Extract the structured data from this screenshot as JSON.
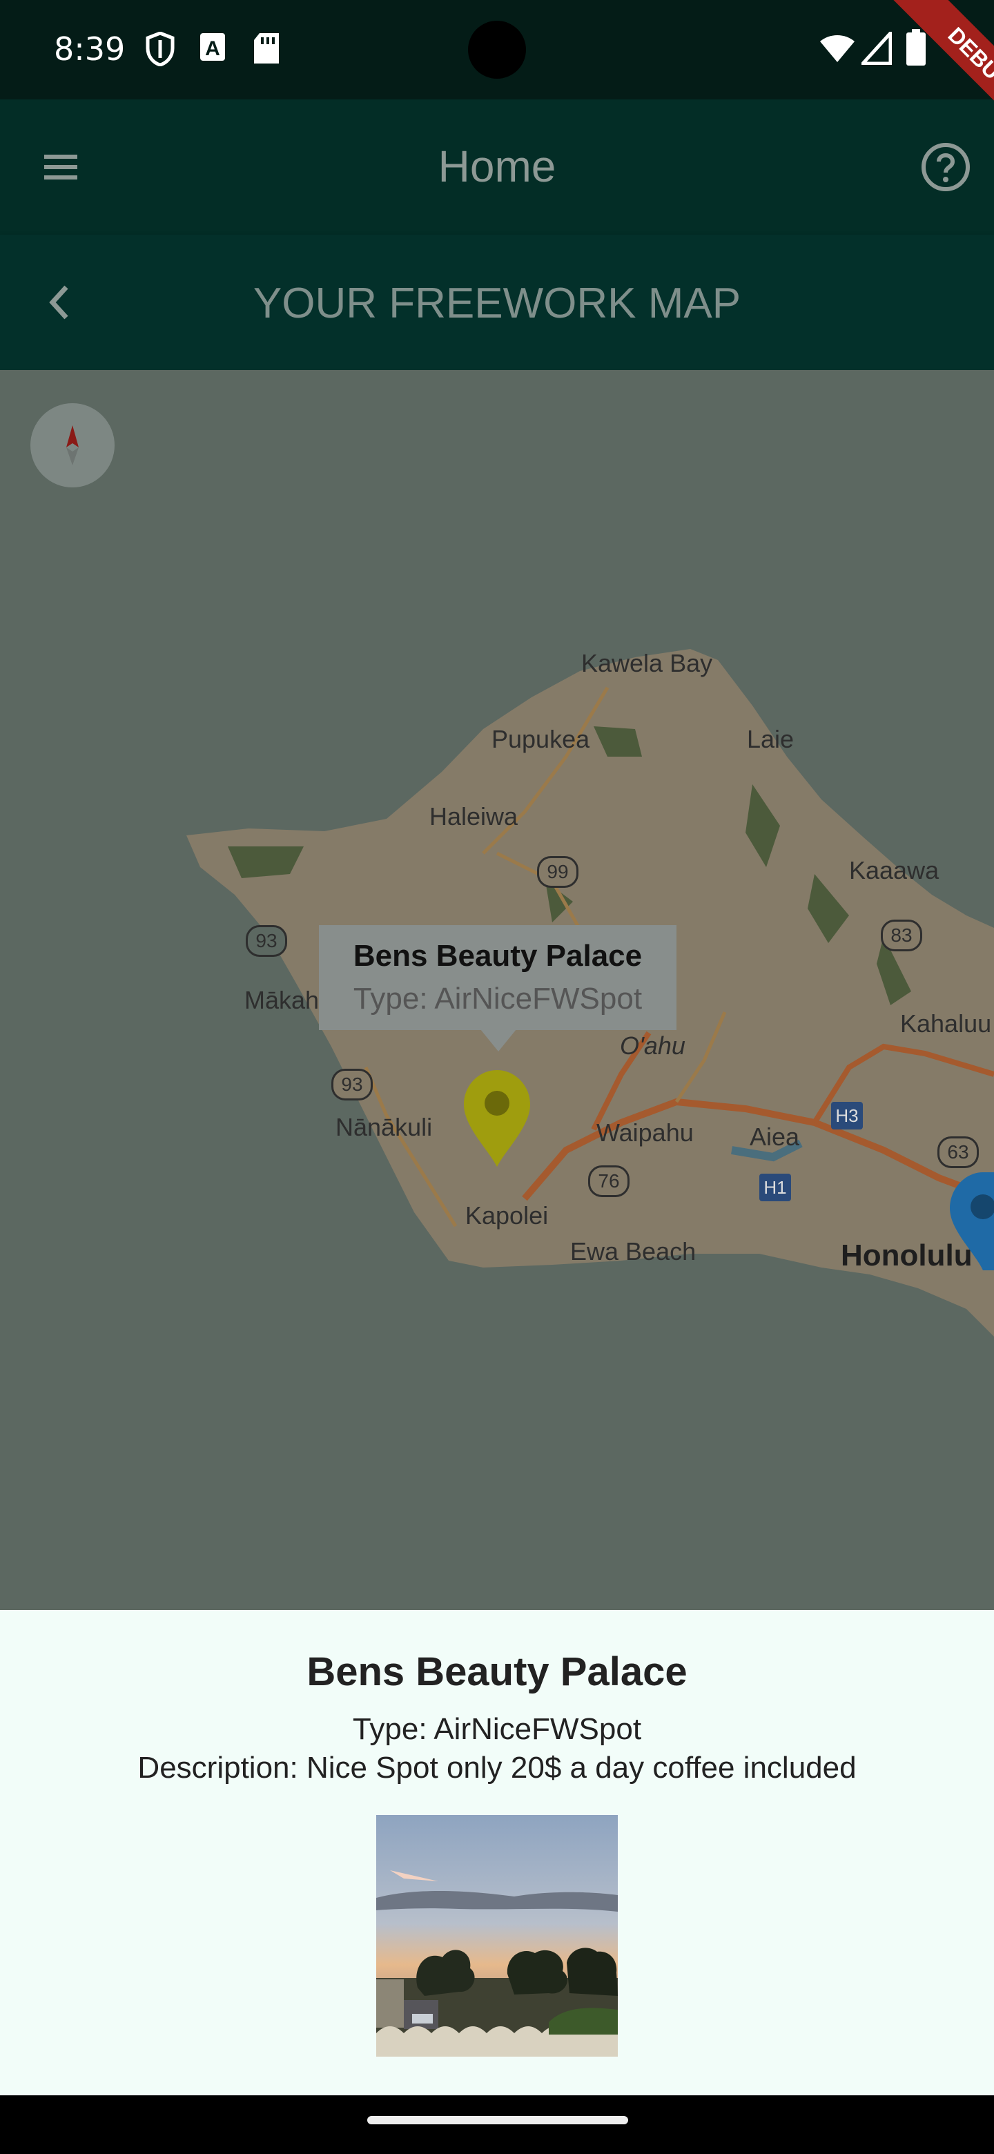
{
  "status_bar": {
    "time": "8:39"
  },
  "app_bar": {
    "title": "Home"
  },
  "sub_header": {
    "title": "YOUR FREEWORK MAP"
  },
  "debug_banner": {
    "label": "DEBUG"
  },
  "map": {
    "labels": {
      "kawela_bay": "Kawela Bay",
      "pupukea": "Pupukea",
      "laie": "Laie",
      "haleiwa": "Haleiwa",
      "kaaawa": "Kaaawa",
      "makaha": "Mākah",
      "kahaluu": "Kahaluu",
      "oahu": "O'ahu",
      "nanakuli": "Nānākuli",
      "waipahu": "Waipahu",
      "aiea": "Aiea",
      "kapolei": "Kapolei",
      "ewa_beach": "Ewa Beach",
      "honolulu": "Honolulu",
      "route_99": "99",
      "route_93_a": "93",
      "route_93_b": "93",
      "route_83": "83",
      "route_63": "63",
      "route_76": "76",
      "route_h1": "H1",
      "route_h3": "H3"
    },
    "info_window": {
      "title": "Bens Beauty Palace",
      "type": "Type: AirNiceFWSpot"
    },
    "marker_colors": {
      "selected": "#9f9d0e",
      "other": "#1f6aa6"
    }
  },
  "detail_sheet": {
    "title": "Bens Beauty Palace",
    "type": "Type: AirNiceFWSpot",
    "description": "Description: Nice Spot only 20$ a day coffee included"
  },
  "colors": {
    "status_bar": "#041c17",
    "app_bar": "#032d26",
    "sheet_bg": "#f2fdf9",
    "map_overlay": "#5c6861"
  }
}
